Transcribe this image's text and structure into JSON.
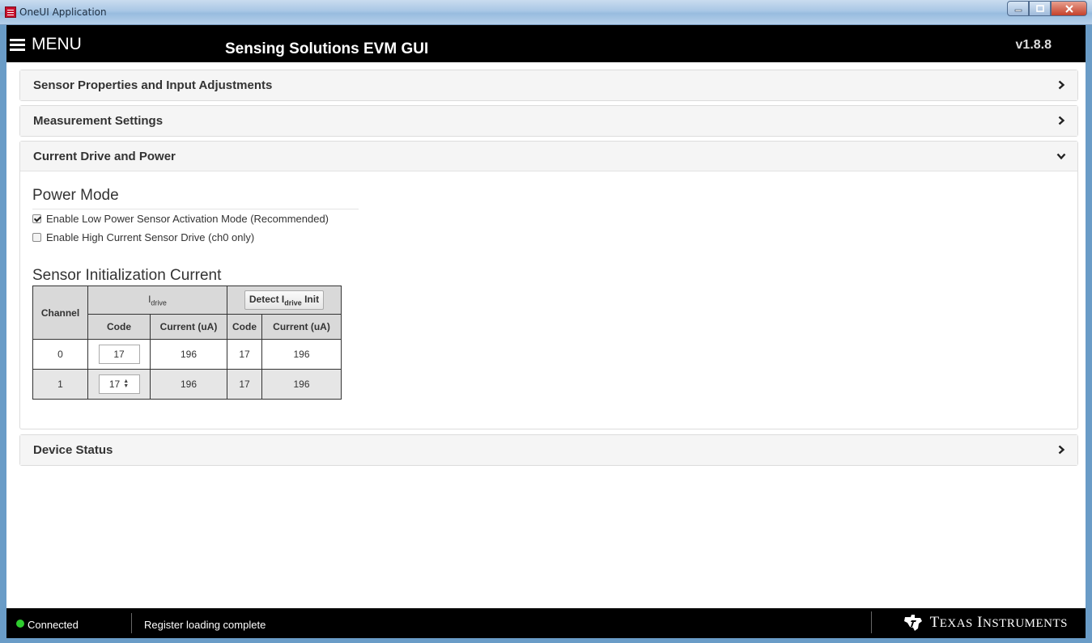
{
  "window": {
    "title": "OneUI Application",
    "controls": [
      "minimize",
      "maximize",
      "close"
    ]
  },
  "header": {
    "menu_label": "MENU",
    "app_title": "Sensing Solutions EVM GUI",
    "version": "v1.8.8"
  },
  "panels": [
    {
      "label": "Sensor Properties and Input Adjustments",
      "state": "collapsed"
    },
    {
      "label": "Measurement Settings",
      "state": "collapsed"
    },
    {
      "label": "Current Drive and Power",
      "state": "expanded"
    },
    {
      "label": "Device Status",
      "state": "collapsed"
    }
  ],
  "power_mode": {
    "title": "Power Mode",
    "options": [
      {
        "label": "Enable Low Power Sensor Activation Mode (Recommended)",
        "checked": true
      },
      {
        "label": "Enable High Current Sensor Drive (ch0 only)",
        "checked": false
      }
    ]
  },
  "sensor_init": {
    "title": "Sensor Initialization Current",
    "headers": {
      "channel": "Channel",
      "idrive_main": "I",
      "idrive_sub": "drive",
      "detect_prefix": "Detect I",
      "detect_sub": "drive",
      "detect_suffix": " Init",
      "code": "Code",
      "current": "Current (uA)",
      "detect_code": "Code",
      "detect_current": "Current (uA)"
    },
    "rows": [
      {
        "channel": "0",
        "code": "17",
        "current": "196",
        "detect_code": "17",
        "detect_current": "196"
      },
      {
        "channel": "1",
        "code": "17",
        "current": "196",
        "detect_code": "17",
        "detect_current": "196"
      }
    ]
  },
  "status": {
    "connection": "Connected",
    "message": "Register loading complete",
    "brand_first": "T",
    "brand_first_rest": "EXAS",
    "brand_second": "I",
    "brand_second_rest": "NSTRUMENTS",
    "connected_color": "#2ecc2e"
  }
}
